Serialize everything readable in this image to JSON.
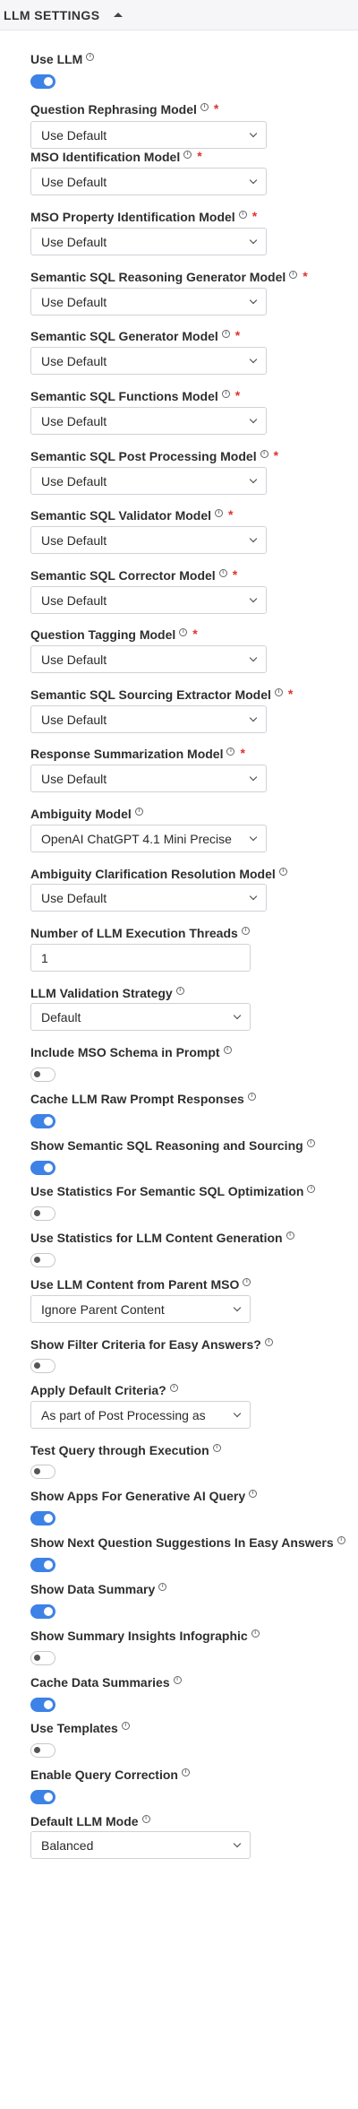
{
  "header": {
    "title": "LLM SETTINGS"
  },
  "fields": {
    "use_llm": {
      "label": "Use LLM",
      "enabled": true
    },
    "question_rephrasing": {
      "label": "Question Rephrasing Model",
      "value": "Use Default"
    },
    "mso_identification": {
      "label": "MSO Identification Model",
      "value": "Use Default"
    },
    "mso_property_identification": {
      "label": "MSO Property Identification Model",
      "value": "Use Default"
    },
    "sql_reasoning_generator": {
      "label": "Semantic SQL Reasoning Generator Model",
      "value": "Use Default"
    },
    "sql_generator": {
      "label": "Semantic SQL Generator Model",
      "value": "Use Default"
    },
    "sql_functions": {
      "label": "Semantic SQL Functions Model",
      "value": "Use Default"
    },
    "sql_post_processing": {
      "label": "Semantic SQL Post Processing Model",
      "value": "Use Default"
    },
    "sql_validator": {
      "label": "Semantic SQL Validator Model",
      "value": "Use Default"
    },
    "sql_corrector": {
      "label": "Semantic SQL Corrector Model",
      "value": "Use Default"
    },
    "question_tagging": {
      "label": "Question Tagging Model",
      "value": "Use Default"
    },
    "sql_sourcing_extractor": {
      "label": "Semantic SQL Sourcing Extractor Model",
      "value": "Use Default"
    },
    "response_summarization": {
      "label": "Response Summarization Model",
      "value": "Use Default"
    },
    "ambiguity_model": {
      "label": "Ambiguity Model",
      "value": "OpenAI ChatGPT 4.1 Mini Precise"
    },
    "ambiguity_clarification": {
      "label": "Ambiguity Clarification Resolution Model",
      "value": "Use Default"
    },
    "llm_threads": {
      "label": "Number of LLM Execution Threads",
      "value": "1"
    },
    "llm_validation_strategy": {
      "label": "LLM Validation Strategy",
      "value": "Default"
    },
    "include_mso_schema": {
      "label": "Include MSO Schema in Prompt",
      "enabled": false
    },
    "cache_raw_prompt": {
      "label": "Cache LLM Raw Prompt Responses",
      "enabled": true
    },
    "show_sql_reasoning": {
      "label": "Show Semantic SQL Reasoning and Sourcing",
      "enabled": true
    },
    "stats_sql_optimization": {
      "label": "Use Statistics For Semantic SQL Optimization",
      "enabled": false
    },
    "stats_content_generation": {
      "label": "Use Statistics for LLM Content Generation",
      "enabled": false
    },
    "content_parent_mso": {
      "label": "Use LLM Content from Parent MSO",
      "value": "Ignore Parent Content"
    },
    "show_filter_criteria": {
      "label": "Show Filter Criteria for Easy Answers?",
      "enabled": false
    },
    "apply_default_criteria": {
      "label": "Apply Default Criteria?",
      "value": "As part of Post Processing as"
    },
    "test_query": {
      "label": "Test Query through Execution",
      "enabled": false
    },
    "show_apps_genai": {
      "label": "Show Apps For Generative AI Query",
      "enabled": true
    },
    "show_next_question": {
      "label": "Show Next Question Suggestions In Easy Answers",
      "enabled": true
    },
    "show_data_summary": {
      "label": "Show Data Summary",
      "enabled": true
    },
    "show_summary_infographic": {
      "label": "Show Summary Insights Infographic",
      "enabled": false
    },
    "cache_data_summaries": {
      "label": "Cache Data Summaries",
      "enabled": true
    },
    "use_templates": {
      "label": "Use Templates",
      "enabled": false
    },
    "enable_query_correction": {
      "label": "Enable Query Correction",
      "enabled": true
    },
    "default_llm_mode": {
      "label": "Default LLM Mode",
      "value": "Balanced"
    }
  },
  "icons": {
    "info": "info-icon",
    "dropdown": "chevron-down-icon",
    "collapse": "chevron-up-icon"
  },
  "colors": {
    "accent": "#3d82e6",
    "required": "#e0322f"
  }
}
